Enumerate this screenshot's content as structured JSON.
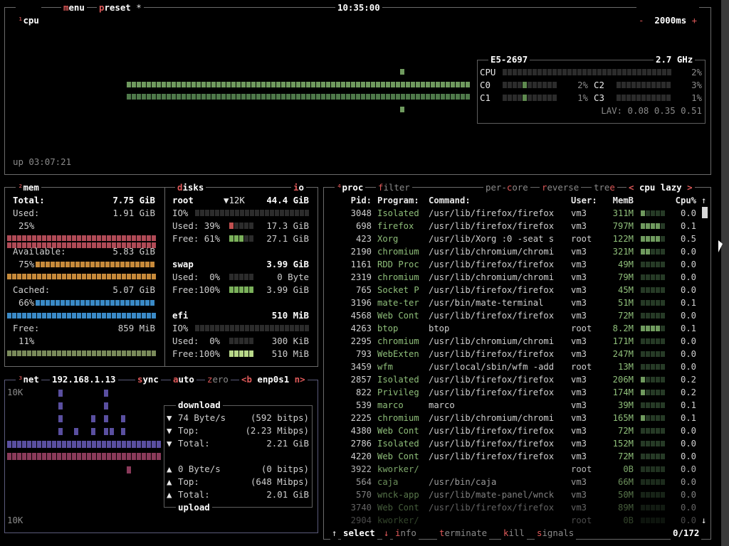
{
  "cpu_box": {
    "num": "¹",
    "title": "cpu",
    "menu_hot": "m",
    "menu_rest": "enu",
    "preset_hot": "p",
    "preset_rest": "reset",
    "preset_star": "*",
    "clock": "10:35:00",
    "minus": "-",
    "interval": "2000ms",
    "plus": "+",
    "uptime": "up 03:07:21",
    "cpu_model": "E5-2697",
    "cpu_freq": "2.7 GHz",
    "total_label": "CPU",
    "total_pct": "2%",
    "cores": [
      {
        "label": "C0",
        "pct": "2%"
      },
      {
        "label": "C1",
        "pct": "1%"
      },
      {
        "label": "C2",
        "pct": "3%"
      },
      {
        "label": "C3",
        "pct": "1%"
      }
    ],
    "lav": "LAV: 0.08 0.35 0.51"
  },
  "mem_box": {
    "num": "²",
    "title": "mem",
    "total_label": "Total:",
    "total_value": "7.75 GiB",
    "used_label": "Used:",
    "used_value": "1.91 GiB",
    "used_pct": "25%",
    "avail_label": "Available:",
    "avail_value": "5.83 GiB",
    "avail_pct": "75%",
    "cached_label": "Cached:",
    "cached_value": "5.07 GiB",
    "cached_pct": "66%",
    "free_label": "Free:",
    "free_value": "859 MiB",
    "free_pct": "11%"
  },
  "disks_box": {
    "title_hot": "d",
    "title_rest": "isks",
    "io_hot": "i",
    "io_rest": "o",
    "disks": [
      {
        "name": "root",
        "io_speed": "▼12K",
        "size": "44.4 GiB",
        "io_label": "IO%",
        "used_label": "Used: 39%",
        "used_value": "17.3 GiB",
        "free_label": "Free: 61%",
        "free_value": "27.1 GiB"
      },
      {
        "name": "swap",
        "size": "3.99 GiB",
        "used_label": "Used:  0%",
        "used_value": "0 Byte",
        "free_label": "Free:100%",
        "free_value": "3.99 GiB"
      },
      {
        "name": "efi",
        "size": "510 MiB",
        "io_label": "IO%",
        "used_label": "Used:  0%",
        "used_value": "300 KiB",
        "free_label": "Free:100%",
        "free_value": "510 MiB"
      }
    ]
  },
  "net_box": {
    "num": "³",
    "title": "net",
    "ip": "192.168.1.13",
    "sync_hot": "s",
    "sync_rest": "ync",
    "auto_hot": "a",
    "auto_rest": "uto",
    "zero_hot": "z",
    "zero_rest": "ero",
    "prev": "<b",
    "iface": "enp0s1",
    "next": "n>",
    "scale_top": "10K",
    "scale_bottom": "10K",
    "download_title": "download",
    "upload_title": "upload",
    "down_rate": "74 Byte/s",
    "down_bits": "(592 bitps)",
    "down_top_label": "Top:",
    "down_top": "(2.23 Mibps)",
    "down_total_label": "Total:",
    "down_total": "2.21 GiB",
    "up_rate": "0 Byte/s",
    "up_bits": "(0 bitps)",
    "up_top_label": "Top:",
    "up_top": "(648 Mibps)",
    "up_total_label": "Total:",
    "up_total": "2.01 GiB"
  },
  "proc_box": {
    "num": "⁴",
    "title": "proc",
    "filter_hot": "f",
    "filter_rest": "ilter",
    "percore_a": "per-",
    "percore_hot": "c",
    "percore_b": "ore",
    "reverse_hot": "r",
    "reverse_rest": "everse",
    "tree_a": "tre",
    "tree_hot": "e",
    "sort_left": "<",
    "sort_field": "cpu lazy",
    "sort_right": ">",
    "headers": {
      "pid": "Pid:",
      "program": "Program:",
      "command": "Command:",
      "user": "User:",
      "mem": "MemB",
      "cpu": "Cpu%"
    },
    "rows": [
      {
        "pid": "3048",
        "program": "Isolated",
        "command": "/usr/lib/firefox/firefox",
        "user": "vm3",
        "mem": "311M",
        "cpu": "0.0"
      },
      {
        "pid": "698",
        "program": "firefox",
        "command": "/usr/lib/firefox/firefox",
        "user": "vm3",
        "mem": "797M",
        "cpu": "0.1"
      },
      {
        "pid": "423",
        "program": "Xorg",
        "command": "/usr/lib/Xorg :0 -seat s",
        "user": "root",
        "mem": "122M",
        "cpu": "0.5"
      },
      {
        "pid": "2190",
        "program": "chromium",
        "command": "/usr/lib/chromium/chromi",
        "user": "vm3",
        "mem": "321M",
        "cpu": "0.0"
      },
      {
        "pid": "1161",
        "program": "RDD Proc",
        "command": "/usr/lib/firefox/firefox",
        "user": "vm3",
        "mem": "49M",
        "cpu": "0.0"
      },
      {
        "pid": "2319",
        "program": "chromium",
        "command": "/usr/lib/chromium/chromi",
        "user": "vm3",
        "mem": "79M",
        "cpu": "0.0"
      },
      {
        "pid": "765",
        "program": "Socket P",
        "command": "/usr/lib/firefox/firefox",
        "user": "vm3",
        "mem": "45M",
        "cpu": "0.0"
      },
      {
        "pid": "3196",
        "program": "mate-ter",
        "command": "/usr/bin/mate-terminal",
        "user": "vm3",
        "mem": "51M",
        "cpu": "0.1"
      },
      {
        "pid": "4568",
        "program": "Web Cont",
        "command": "/usr/lib/firefox/firefox",
        "user": "vm3",
        "mem": "72M",
        "cpu": "0.0"
      },
      {
        "pid": "4263",
        "program": "btop",
        "command": "btop",
        "user": "root",
        "mem": "8.2M",
        "cpu": "0.1"
      },
      {
        "pid": "2295",
        "program": "chromium",
        "command": "/usr/lib/chromium/chromi",
        "user": "vm3",
        "mem": "171M",
        "cpu": "0.0"
      },
      {
        "pid": "793",
        "program": "WebExten",
        "command": "/usr/lib/firefox/firefox",
        "user": "vm3",
        "mem": "247M",
        "cpu": "0.0"
      },
      {
        "pid": "3459",
        "program": "wfm",
        "command": "/usr/local/sbin/wfm -add",
        "user": "root",
        "mem": "13M",
        "cpu": "0.0"
      },
      {
        "pid": "2857",
        "program": "Isolated",
        "command": "/usr/lib/firefox/firefox",
        "user": "vm3",
        "mem": "206M",
        "cpu": "0.2"
      },
      {
        "pid": "822",
        "program": "Privileg",
        "command": "/usr/lib/firefox/firefox",
        "user": "vm3",
        "mem": "174M",
        "cpu": "0.2"
      },
      {
        "pid": "539",
        "program": "marco",
        "command": "marco",
        "user": "vm3",
        "mem": "39M",
        "cpu": "0.1"
      },
      {
        "pid": "2225",
        "program": "chromium",
        "command": "/usr/lib/chromium/chromi",
        "user": "vm3",
        "mem": "165M",
        "cpu": "0.1"
      },
      {
        "pid": "4380",
        "program": "Web Cont",
        "command": "/usr/lib/firefox/firefox",
        "user": "vm3",
        "mem": "72M",
        "cpu": "0.0"
      },
      {
        "pid": "2786",
        "program": "Isolated",
        "command": "/usr/lib/firefox/firefox",
        "user": "vm3",
        "mem": "152M",
        "cpu": "0.0"
      },
      {
        "pid": "4220",
        "program": "Web Cont",
        "command": "/usr/lib/firefox/firefox",
        "user": "vm3",
        "mem": "72M",
        "cpu": "0.0"
      },
      {
        "pid": "3922",
        "program": "kworker/",
        "command": "",
        "user": "root",
        "mem": "0B",
        "cpu": "0.0"
      },
      {
        "pid": "564",
        "program": "caja",
        "command": "/usr/bin/caja",
        "user": "vm3",
        "mem": "66M",
        "cpu": "0.0"
      },
      {
        "pid": "570",
        "program": "wnck-app",
        "command": "/usr/lib/mate-panel/wnck",
        "user": "vm3",
        "mem": "50M",
        "cpu": "0.0"
      },
      {
        "pid": "3740",
        "program": "Web Cont",
        "command": "/usr/lib/firefox/firefox",
        "user": "vm3",
        "mem": "89M",
        "cpu": "0.0"
      },
      {
        "pid": "2904",
        "program": "kworker/",
        "command": "",
        "user": "root",
        "mem": "0B",
        "cpu": "0.0"
      }
    ],
    "footer": {
      "up_arrow": "↑",
      "select": "select",
      "down_arrow": "↓",
      "info_hot": "i",
      "info_rest": "nfo",
      "terminate_hot": "t",
      "terminate_rest": "erminate",
      "kill_hot": "k",
      "kill_rest": "ill",
      "signals_hot": "s",
      "signals_rest": "ignals",
      "count": "0/172"
    },
    "scroll_up": "↑",
    "scroll_down": "↓"
  },
  "colors": {
    "accent_red": "#e05a5a",
    "cpu_graph": "#6f9a5e",
    "net_down": "#5a4fa0",
    "net_up": "#8a3a5a"
  }
}
